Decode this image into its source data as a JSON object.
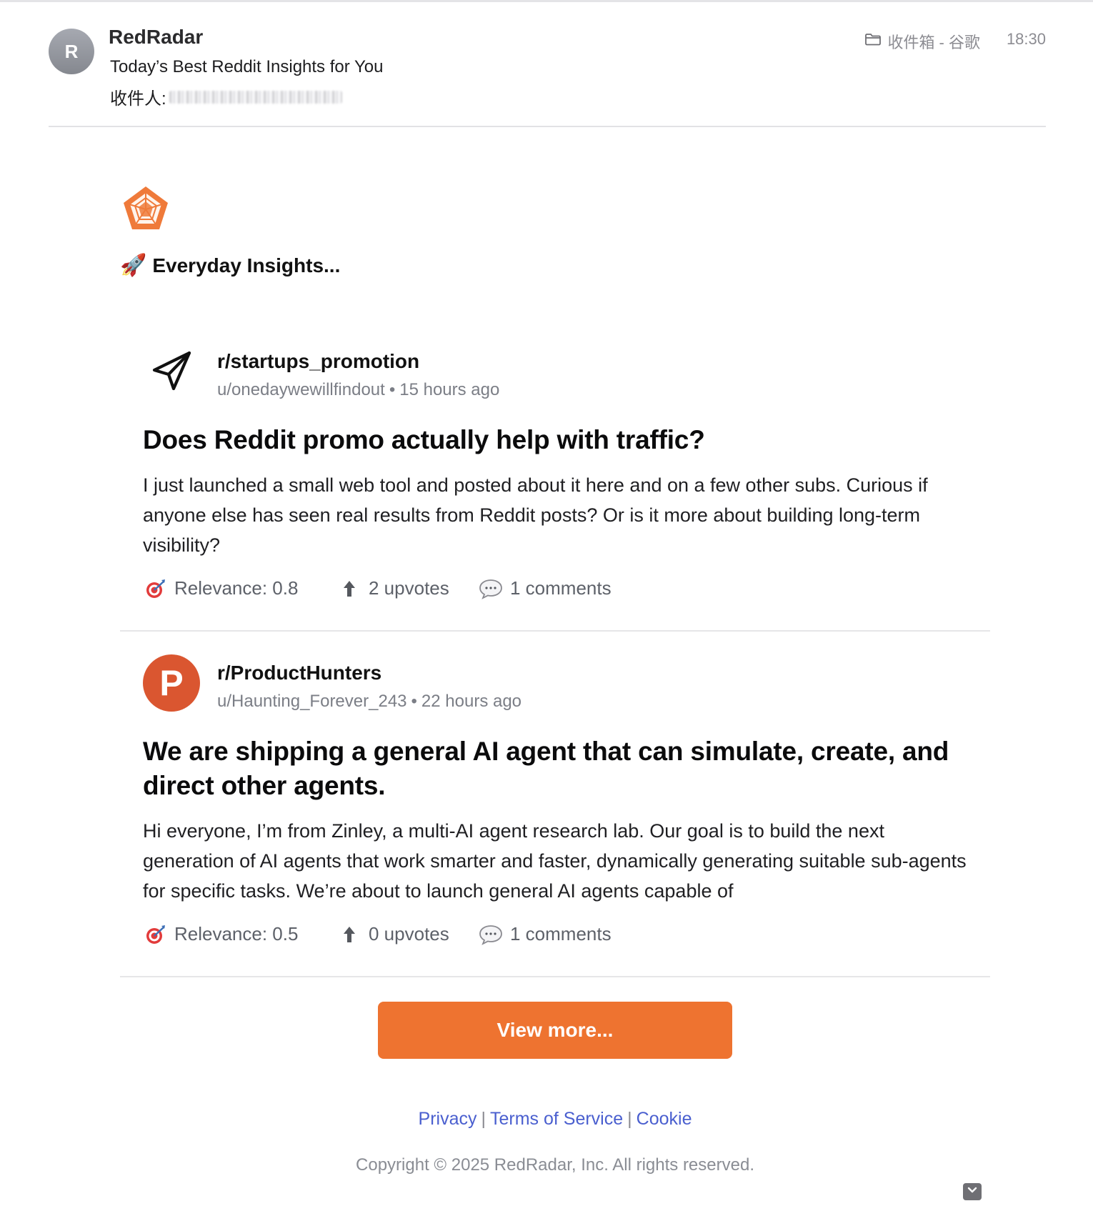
{
  "header": {
    "avatar_letter": "R",
    "sender": "RedRadar",
    "subject": "Today’s Best Reddit Insights for You",
    "recipient_label": "收件人:",
    "folder": "收件箱 - 谷歌",
    "time": "18:30"
  },
  "intro": {
    "emoji": "🚀",
    "heading": "Everyday Insights..."
  },
  "posts": [
    {
      "icon": "paper-plane-icon",
      "subreddit": "r/startups_promotion",
      "author": "u/onedaywewillfindout",
      "time": "15 hours ago",
      "title": "Does Reddit promo actually help with traffic?",
      "body": "I just launched a small web tool and posted about it here and on a few other subs. Curious if anyone else has seen real results from Reddit posts? Or is it more about building long-term visibility?",
      "relevance": "Relevance: 0.8",
      "upvotes": "2 upvotes",
      "comments": "1 comments"
    },
    {
      "icon": "producthunt-icon",
      "icon_letter": "P",
      "subreddit": "r/ProductHunters",
      "author": "u/Haunting_Forever_243",
      "time": "22 hours ago",
      "title": "We are shipping a general AI agent that can simulate, create, and direct other agents.",
      "body": "Hi everyone, I’m from Zinley, a multi-AI agent research lab. Our goal is to build the next generation of AI agents that work smarter and faster, dynamically generating suitable sub-agents for specific tasks. We’re about to launch general AI agents capable of",
      "relevance": "Relevance: 0.5",
      "upvotes": "0 upvotes",
      "comments": "1 comments"
    }
  ],
  "cta": {
    "label": "View more..."
  },
  "footer": {
    "privacy": "Privacy",
    "terms": "Terms of Service",
    "cookie": "Cookie",
    "separator": "|",
    "copyright": "Copyright © 2025 RedRadar, Inc. All rights reserved."
  },
  "colors": {
    "accent": "#ee7330",
    "link": "#4a5fcf",
    "producthunt": "#da5630"
  }
}
